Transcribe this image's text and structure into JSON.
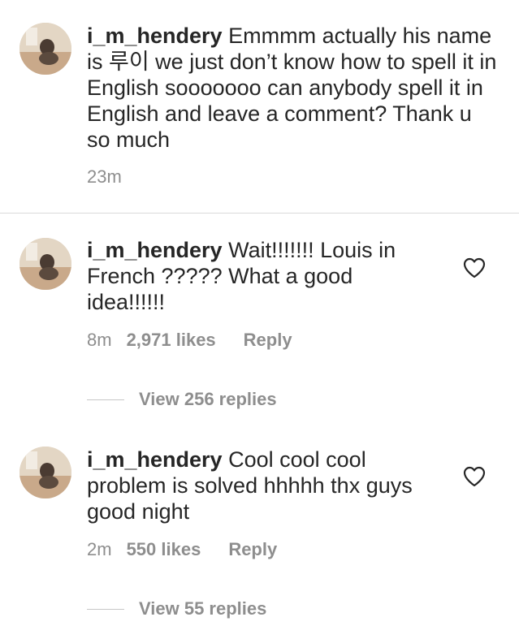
{
  "comments": [
    {
      "username": "i_m_hendery",
      "text": "Emmmm actually his name is 루이 we just don’t know how to spell it in English sooooooo can anybody spell it in English and leave a comment? Thank u so much",
      "time": "23m"
    },
    {
      "username": "i_m_hendery",
      "text": "Wait!!!!!!! Louis in French ????? What a good idea!!!!!!",
      "time": "8m",
      "likes": "2,971 likes",
      "reply_label": "Reply",
      "view_replies": "View 256 replies"
    },
    {
      "username": "i_m_hendery",
      "text": "Cool cool cool problem is solved hhhhh thx guys good night",
      "time": "2m",
      "likes": "550 likes",
      "reply_label": "Reply",
      "view_replies": "View 55 replies"
    }
  ],
  "icons": {
    "like": "heart-outline-icon",
    "avatar": "profile-photo"
  },
  "colors": {
    "text": "#262626",
    "muted": "#8e8e8e",
    "divider": "#dbdbdb"
  }
}
